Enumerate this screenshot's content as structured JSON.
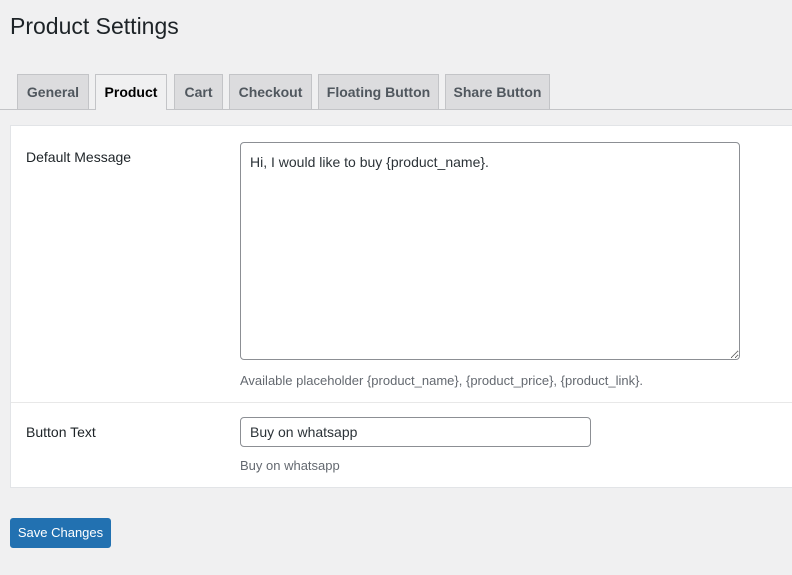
{
  "page": {
    "title": "Product Settings"
  },
  "tabs": [
    {
      "label": "General",
      "active": false
    },
    {
      "label": "Product",
      "active": true
    },
    {
      "label": "Cart",
      "active": false
    },
    {
      "label": "Checkout",
      "active": false
    },
    {
      "label": "Floating Button",
      "active": false
    },
    {
      "label": "Share Button",
      "active": false
    }
  ],
  "fields": {
    "default_message": {
      "label": "Default Message",
      "value": "Hi, I would like to buy {product_name}.",
      "help": "Available placeholder {product_name}, {product_price}, {product_link}."
    },
    "button_text": {
      "label": "Button Text",
      "value": "Buy on whatsapp",
      "help": "Buy on whatsapp"
    }
  },
  "actions": {
    "save_label": "Save Changes"
  },
  "colors": {
    "background": "#f0f0f1",
    "accent": "#2271b1",
    "tab_inactive": "#dcdcde",
    "border": "#c3c4c7"
  }
}
